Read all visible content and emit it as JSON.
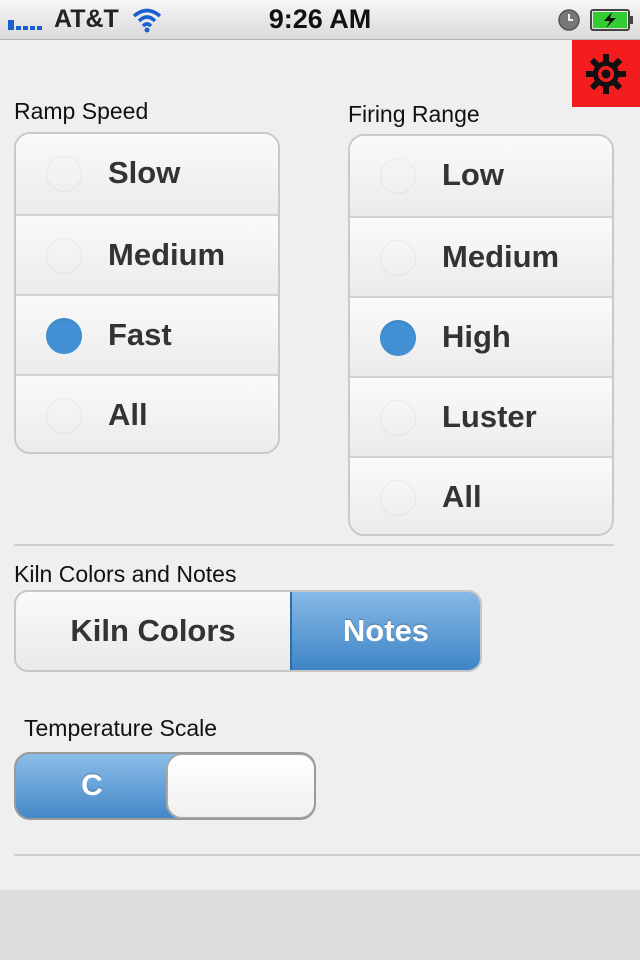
{
  "status_bar": {
    "carrier": "AT&T",
    "time": "9:26 AM",
    "battery_color": "#33cc33"
  },
  "settings_button": {
    "icon": "gear-icon",
    "bg_color": "#f31d1f"
  },
  "ramp_speed": {
    "label": "Ramp Speed",
    "options": [
      "Slow",
      "Medium",
      "Fast",
      "All"
    ],
    "selected": "Fast"
  },
  "firing_range": {
    "label": "Firing Range",
    "options": [
      "Low",
      "Medium",
      "High",
      "Luster",
      "All"
    ],
    "selected": "High"
  },
  "kiln_colors_notes": {
    "label": "Kiln Colors and Notes",
    "options": [
      "Kiln Colors",
      "Notes"
    ],
    "selected": "Notes"
  },
  "temperature_scale": {
    "label": "Temperature Scale",
    "value": "C"
  },
  "accent_color": "#4290d3"
}
